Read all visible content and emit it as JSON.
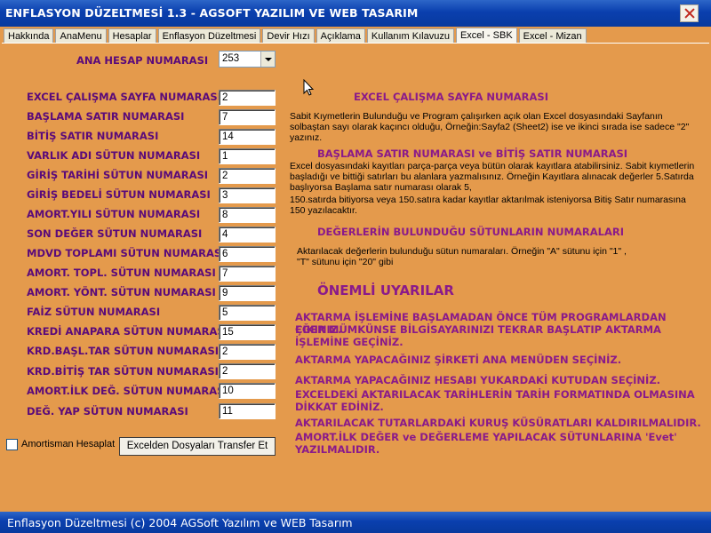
{
  "window": {
    "title": "ENFLASYON DÜZELTMESİ 1.3 - AGSOFT YAZILIM VE WEB TASARIM"
  },
  "tabs": [
    {
      "label": "Hakkında"
    },
    {
      "label": "AnaMenu"
    },
    {
      "label": "Hesaplar"
    },
    {
      "label": "Enflasyon Düzeltmesi"
    },
    {
      "label": "Devir Hızı"
    },
    {
      "label": "Açıklama"
    },
    {
      "label": "Kullanım Kılavuzu"
    },
    {
      "label": "Excel - SBK",
      "active": true
    },
    {
      "label": "Excel - Mizan"
    }
  ],
  "form": {
    "ana_hesap_label": "ANA HESAP NUMARASI",
    "ana_hesap_value": "253",
    "fields": [
      {
        "label": "EXCEL ÇALIŞMA SAYFA NUMARASI",
        "value": "2"
      },
      {
        "label": "BAŞLAMA SATIR NUMARASI",
        "value": "7"
      },
      {
        "label": "BİTİŞ SATIR NUMARASI",
        "value": "14"
      },
      {
        "label": "VARLIK ADI SÜTUN NUMARASI",
        "value": "1"
      },
      {
        "label": "GİRİŞ TARİHİ SÜTUN NUMARASI",
        "value": "2"
      },
      {
        "label": "GİRİŞ BEDELİ SÜTUN NUMARASI",
        "value": "3"
      },
      {
        "label": "AMORT.YILI SÜTUN NUMARASI",
        "value": "8"
      },
      {
        "label": "SON DEĞER SÜTUN NUMARASI",
        "value": "4"
      },
      {
        "label": "MDVD TOPLAMI SÜTUN NUMARASI",
        "value": "6"
      },
      {
        "label": "AMORT. TOPL. SÜTUN NUMARASI",
        "value": "7"
      },
      {
        "label": "AMORT. YÖNT. SÜTUN NUMARASI",
        "value": "9"
      },
      {
        "label": "FAİZ SÜTUN NUMARASI",
        "value": "5"
      },
      {
        "label": "KREDİ ANAPARA SÜTUN NUMARASI",
        "value": "15"
      },
      {
        "label": "KRD.BAŞL.TAR SÜTUN NUMARASI",
        "value": "2"
      },
      {
        "label": "KRD.BİTİŞ TAR SÜTUN NUMARASI",
        "value": "2"
      },
      {
        "label": "AMORT.İLK DEĞ. SÜTUN NUMARASI",
        "value": "10"
      },
      {
        "label": "DEĞ. YAP SÜTUN NUMARASI",
        "value": "11"
      }
    ],
    "checkbox_label": "Amortisman Hesaplat",
    "transfer_button": "Excelden Dosyaları Transfer Et"
  },
  "info": {
    "h1": "EXCEL ÇALIŞMA SAYFA NUMARASI",
    "p1_l1": "Sabit Kıymetlerin Bulunduğu ve Program çalışırken açık olan Excel dosyasındaki Sayfanın",
    "p1_l2": "solbaştan sayı olarak kaçıncı olduğu, Örneğin:Sayfa2 (Sheet2) ise ve ikinci sırada ise sadece \"2\"",
    "p1_l3": "yazınız.",
    "h2": "BAŞLAMA SATIR NUMARASI ve BİTİŞ SATIR NUMARASI",
    "p2_l1": "Excel dosyasındaki kayıtları parça-parça veya bütün olarak kayıtlara atabilirsiniz. Sabit kıymetlerin",
    "p2_l2": "başladığı ve bittiği  satırları bu alanlara yazmalısınız. Örneğin Kayıtlara alınacak değerler 5.Satırda",
    "p2_l3": "başlıyorsa Başlama satır numarası olarak 5,",
    "p2_l4": "150.satırda bitiyorsa veya 150.satıra kadar kayıtlar aktarılmak isteniyorsa Bitiş Satır numarasına",
    "p2_l5": "150 yazılacaktır.",
    "h3": "DEĞERLERİN BULUNDUĞU SÜTUNLARIN NUMARALARI",
    "p3_l1": "Aktarılacak değerlerin bulunduğu sütun numaraları. Örneğin \"A\" sütunu için \"1\" ,",
    "p3_l2": "\"T\" sütunu için \"20\" gibi",
    "h4": "ÖNEMLİ UYARILAR",
    "w1_l1": "AKTARMA İŞLEMİNE BAŞLAMADAN ÖNCE TÜM PROGRAMLARDAN ÇIKINIZ.",
    "w1_l2": "EĞER MÜMKÜNSE BİLGİSAYARINIZI TEKRAR BAŞLATIP AKTARMA",
    "w1_l3": "İŞLEMİNE GEÇİNİZ.",
    "w2": "AKTARMA YAPACAĞINIZ ŞİRKETİ ANA MENÜDEN SEÇİNİZ.",
    "w3": "AKTARMA YAPACAĞINIZ HESABI YUKARDAKİ KUTUDAN  SEÇİNİZ.",
    "w4_l1": "EXCELDEKİ AKTARILACAK TARİHLERİN TARİH FORMATINDA OLMASINA",
    "w4_l2": "DİKKAT EDİNİZ.",
    "w5": "AKTARILACAK TUTARLARDAKİ KURUŞ KÜSÜRATLARI KALDIRILMALIDIR.",
    "w6_l1": "AMORT.İLK DEĞER ve  DEĞERLEME YAPILACAK SÜTUNLARINA 'Evet'",
    "w6_l2": "YAZILMALIDIR."
  },
  "statusbar": {
    "text": "Enflasyon Düzeltmesi (c) 2004 AGSoft Yazılım ve WEB Tasarım"
  },
  "colors": {
    "background": "#e49a4c",
    "titlebar": "#0a3fae",
    "label": "#5a0a7a",
    "heading": "#8a1a8a"
  }
}
